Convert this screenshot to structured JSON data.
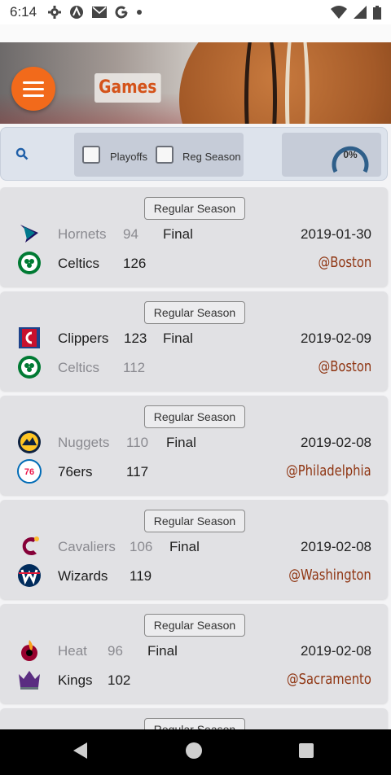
{
  "status_bar": {
    "time": "6:14",
    "icons": [
      "gear-icon",
      "a-circle-icon",
      "mail-icon",
      "google-icon",
      "dot-icon"
    ],
    "right_icons": [
      "wifi-icon",
      "signal-icon",
      "battery-icon"
    ]
  },
  "header": {
    "title": "Games",
    "menu_icon": "hamburger-icon"
  },
  "filters": {
    "search_icon": "search-icon",
    "playoffs_label": "Playoffs",
    "reg_season_label": "Reg Season",
    "progress_text": "0%",
    "progress": 0
  },
  "games": [
    {
      "badge": "Regular Season",
      "status": "Final",
      "date": "2019-01-30",
      "location": "@Boston",
      "away": {
        "name": "Hornets",
        "score": "94",
        "logo": "hornets-logo-icon",
        "winner": false
      },
      "home": {
        "name": "Celtics",
        "score": "126",
        "logo": "celtics-logo-icon",
        "winner": true
      }
    },
    {
      "badge": "Regular Season",
      "status": "Final",
      "date": "2019-02-09",
      "location": "@Boston",
      "away": {
        "name": "Clippers",
        "score": "123",
        "logo": "clippers-logo-icon",
        "winner": true
      },
      "home": {
        "name": "Celtics",
        "score": "112",
        "logo": "celtics-logo-icon",
        "winner": false
      }
    },
    {
      "badge": "Regular Season",
      "status": "Final",
      "date": "2019-02-08",
      "location": "@Philadelphia",
      "away": {
        "name": "Nuggets",
        "score": "110",
        "logo": "nuggets-logo-icon",
        "winner": false
      },
      "home": {
        "name": "76ers",
        "score": "117",
        "logo": "76ers-logo-icon",
        "winner": true
      }
    },
    {
      "badge": "Regular Season",
      "status": "Final",
      "date": "2019-02-08",
      "location": "@Washington",
      "away": {
        "name": "Cavaliers",
        "score": "106",
        "logo": "cavaliers-logo-icon",
        "winner": false
      },
      "home": {
        "name": "Wizards",
        "score": "119",
        "logo": "wizards-logo-icon",
        "winner": true
      }
    },
    {
      "badge": "Regular Season",
      "status": "Final",
      "date": "2019-02-08",
      "location": "@Sacramento",
      "away": {
        "name": "Heat",
        "score": "96",
        "logo": "heat-logo-icon",
        "winner": false
      },
      "home": {
        "name": "Kings",
        "score": "102",
        "logo": "kings-logo-icon",
        "winner": true
      }
    },
    {
      "badge": "Regular Season"
    }
  ],
  "colors": {
    "accent": "#f26a1b",
    "location": "#8f3512",
    "loser_text": "#8a8a90"
  }
}
